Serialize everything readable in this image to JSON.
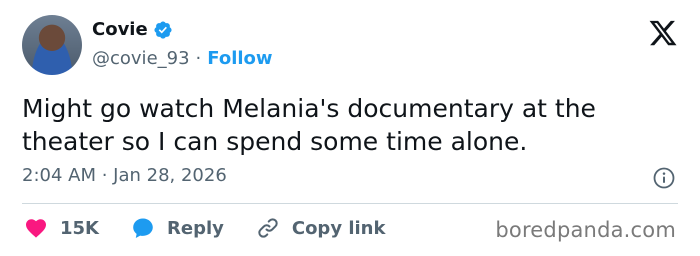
{
  "user": {
    "name": "Covie",
    "handle": "@covie_93",
    "separator": "·",
    "follow_label": "Follow"
  },
  "tweet": {
    "text": "Might go watch Melania's documentary at the theater so I can spend some time alone.",
    "timestamp": "2:04 AM · Jan 28, 2026"
  },
  "actions": {
    "likes": "15K",
    "reply_label": "Reply",
    "copy_label": "Copy link"
  },
  "watermark": "boredpanda.com",
  "colors": {
    "accent": "#1d9bf0",
    "heart": "#f91880",
    "text": "#0f1419",
    "muted": "#536471"
  },
  "icons": [
    "verified-badge-icon",
    "x-logo-icon",
    "info-icon",
    "heart-icon",
    "reply-bubble-icon",
    "link-icon"
  ]
}
